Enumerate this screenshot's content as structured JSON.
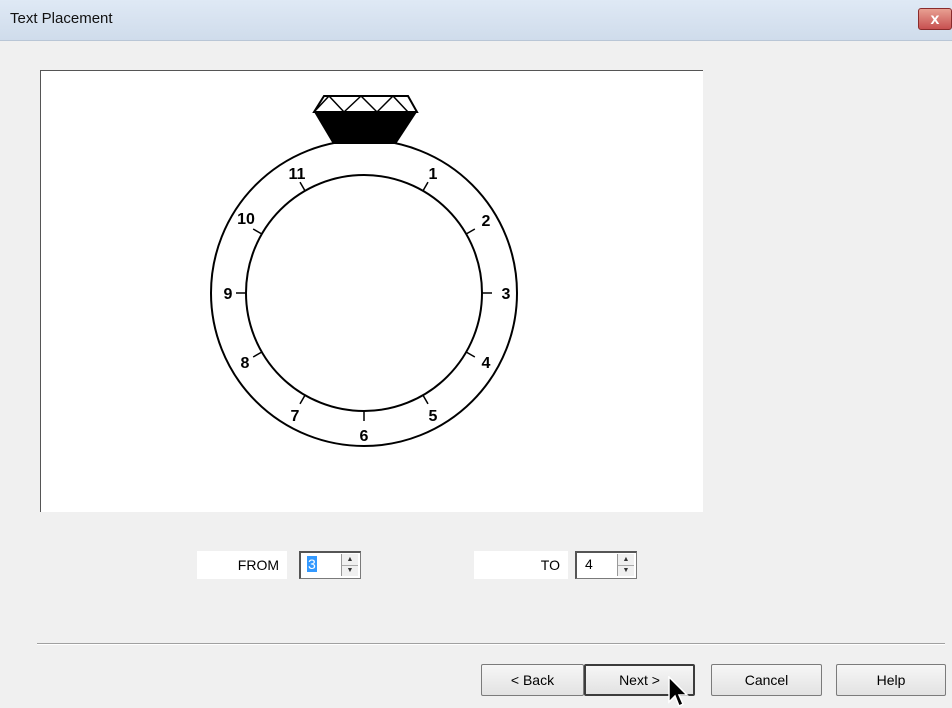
{
  "window": {
    "title": "Text Placement",
    "close_glyph": "x"
  },
  "ring": {
    "positions": [
      "11",
      "1",
      "10",
      "2",
      "9",
      "3",
      "8",
      "4",
      "7",
      "5",
      "6"
    ]
  },
  "from": {
    "label": "FROM",
    "value": "3"
  },
  "to": {
    "label": "TO",
    "value": "4"
  },
  "buttons": {
    "back": "< Back",
    "next": "Next >",
    "cancel": "Cancel",
    "help": "Help"
  },
  "icons": {
    "close": "close-icon",
    "spin_up": "spin-up-arrow-icon",
    "spin_down": "spin-down-arrow-icon",
    "cursor": "mouse-pointer-icon"
  }
}
